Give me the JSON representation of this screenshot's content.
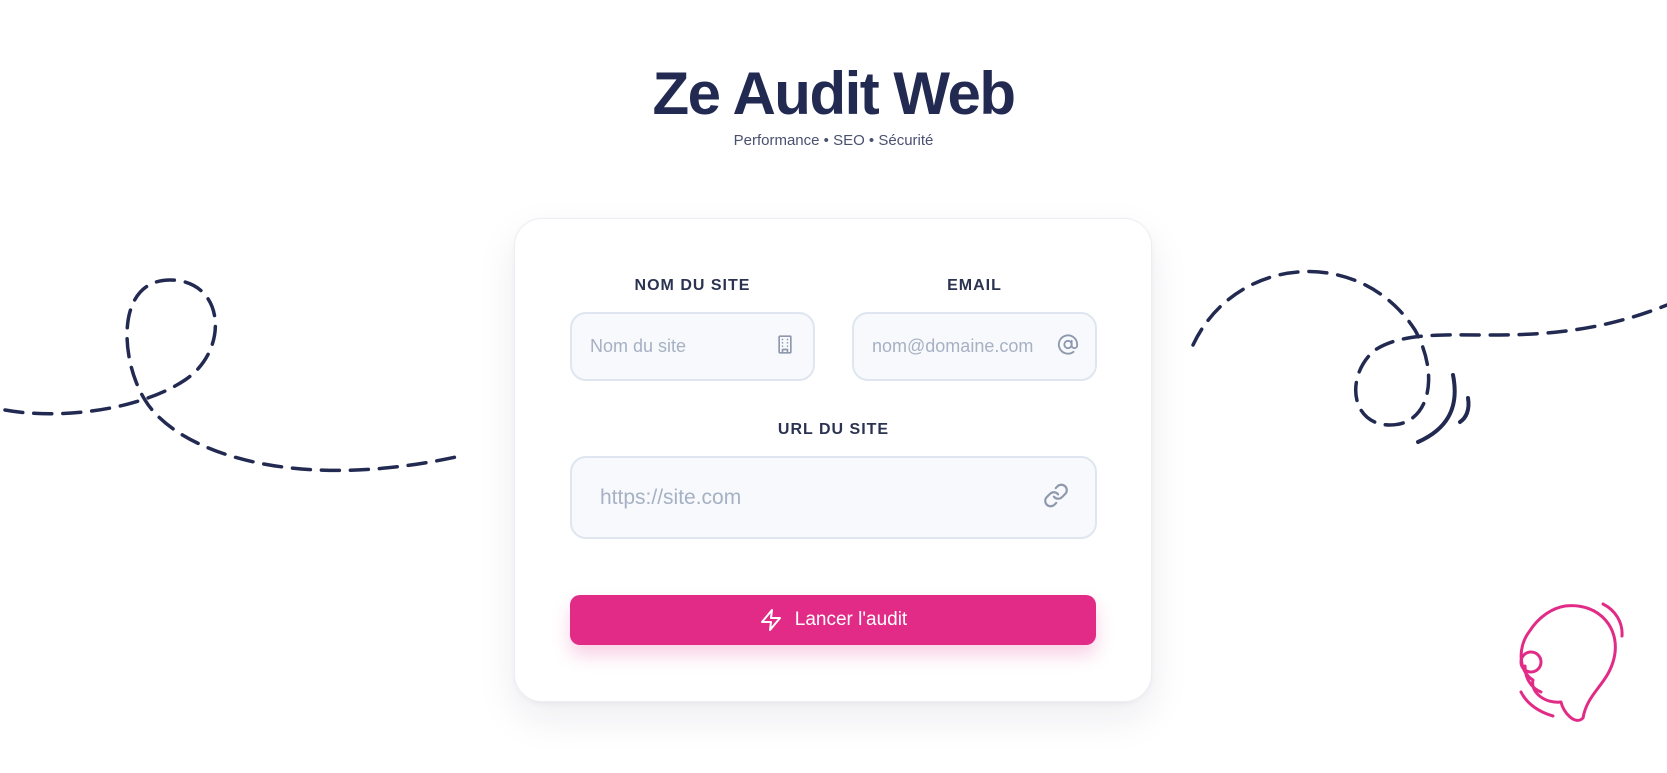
{
  "app": {
    "title": "Ze Audit Web",
    "subtitle": "Performance • SEO • Sécurité"
  },
  "form": {
    "site_name": {
      "label": "NOM DU SITE",
      "placeholder": "Nom du site",
      "value": "",
      "icon": "building-icon"
    },
    "email": {
      "label": "EMAIL",
      "placeholder": "nom@domaine.com",
      "value": "",
      "icon": "at-sign-icon"
    },
    "url": {
      "label": "URL DU SITE",
      "placeholder": "https://site.com",
      "value": "",
      "icon": "link-icon"
    },
    "submit": {
      "label": "Lancer l'audit",
      "icon": "lightning-bolt-icon"
    }
  },
  "colors": {
    "primary": "#e12b86",
    "ink": "#222a52",
    "field_bg": "#f7f9fc",
    "field_border": "#dfe6f0",
    "placeholder": "#a6b1c3"
  }
}
